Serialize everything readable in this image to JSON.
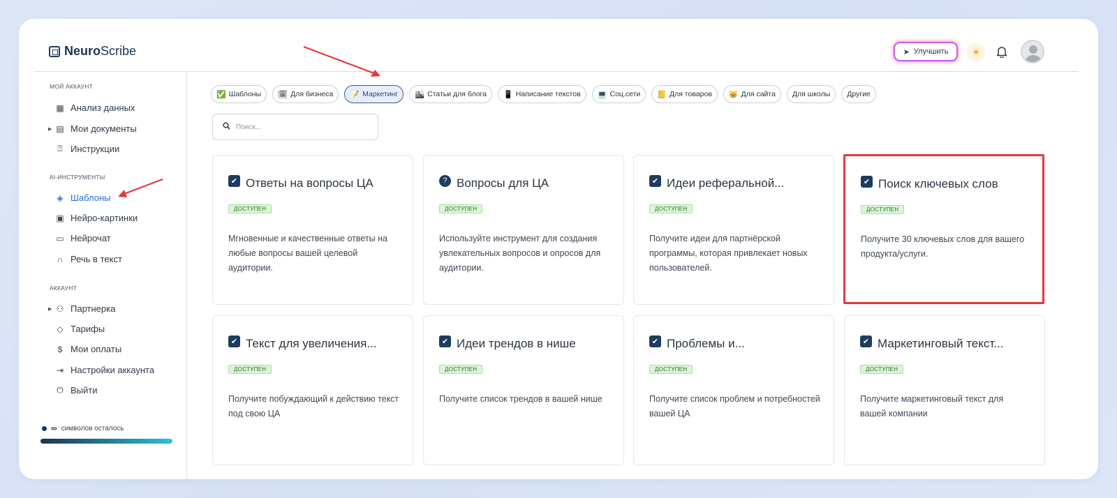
{
  "app": {
    "logo_bold": "Neuro",
    "logo_rest": "Scribe"
  },
  "header": {
    "upgrade_label": "Улучшить"
  },
  "sidebar": {
    "section_account_label": "МОЙ АККАУНТ",
    "account_items": [
      {
        "label": "Анализ данных",
        "icon": "grid-icon"
      },
      {
        "label": "Мои документы",
        "icon": "document-icon"
      },
      {
        "label": "Инструкции",
        "icon": "help-circle-icon"
      }
    ],
    "section_ai_label": "AI-ИНСТРУМЕНТЫ",
    "ai_items": [
      {
        "label": "Шаблоны",
        "icon": "layers-icon",
        "active": true
      },
      {
        "label": "Нейро-картинки",
        "icon": "image-icon"
      },
      {
        "label": "Нейрочат",
        "icon": "chat-icon"
      },
      {
        "label": "Речь в текст",
        "icon": "headphones-icon"
      }
    ],
    "section_profile_label": "АККАУНТ",
    "profile_items": [
      {
        "label": "Партнерка",
        "icon": "users-icon"
      },
      {
        "label": "Тарифы",
        "icon": "tag-icon"
      },
      {
        "label": "Мои оплаты",
        "icon": "dollar-icon"
      },
      {
        "label": "Настройки аккаунта",
        "icon": "login-icon"
      },
      {
        "label": "Выйти",
        "icon": "power-icon"
      }
    ],
    "symbols_infinity": "∞",
    "symbols_label": "символов осталось",
    "symbols_progress": 1.0
  },
  "filters": {
    "chips": [
      {
        "label": "Шаблоны",
        "icon": "✅"
      },
      {
        "label": "Для бизнеса",
        "icon": "🗓"
      },
      {
        "label": "Маркетинг",
        "icon": "📝",
        "active": true
      },
      {
        "label": "Статьи для блога",
        "icon": "🏙"
      },
      {
        "label": "Написание текстов",
        "icon": "📱"
      },
      {
        "label": "Соц.сети",
        "icon": "💻"
      },
      {
        "label": "Для товаров",
        "icon": "📒"
      },
      {
        "label": "Для сайта",
        "icon": "😸"
      },
      {
        "label": "Для школы",
        "icon": ""
      },
      {
        "label": "Другие",
        "icon": ""
      }
    ]
  },
  "search": {
    "placeholder": "Поиск..."
  },
  "cards": [
    {
      "title": "Ответы на вопросы ЦА",
      "badge": "ДОСТУПЕН",
      "desc": "Мгновенные и качественные ответы на любые вопросы вашей целевой аудитории.",
      "icon": "✔"
    },
    {
      "title": "Вопросы для ЦА",
      "badge": "ДОСТУПЕН",
      "desc": "Используйте инструмент для создания увлекательных вопросов и опросов для аудитории.",
      "icon": "?"
    },
    {
      "title": "Идеи реферальной...",
      "badge": "ДОСТУПЕН",
      "desc": "Получите идеи для партнёрской программы, которая привлекает новых пользователей.",
      "icon": "✔"
    },
    {
      "title": "Поиск ключевых слов",
      "badge": "ДОСТУПЕН",
      "desc": "Получите 30 ключевых слов для вашего продукта/услуги.",
      "icon": "✔"
    },
    {
      "title": "Текст для увеличения...",
      "badge": "ДОСТУПЕН",
      "desc": "Получите побуждающий к действию текст под свою ЦА",
      "icon": "✔"
    },
    {
      "title": "Идеи трендов в нише",
      "badge": "ДОСТУПЕН",
      "desc": "Получите список трендов в вашей нише",
      "icon": "✔"
    },
    {
      "title": "Проблемы и...",
      "badge": "ДОСТУПЕН",
      "desc": "Получите список проблем и потребностей вашей ЦА",
      "icon": "✔"
    },
    {
      "title": "Маркетинговый текст...",
      "badge": "ДОСТУПЕН",
      "desc": "Получите маркетинговый текст для вашей компании",
      "icon": "✔"
    }
  ],
  "colors": {
    "accent": "#2a6fdb",
    "annotation_red": "#e5393a",
    "brand_dark": "#1b3356",
    "badge_bg": "#d9f7d5"
  }
}
